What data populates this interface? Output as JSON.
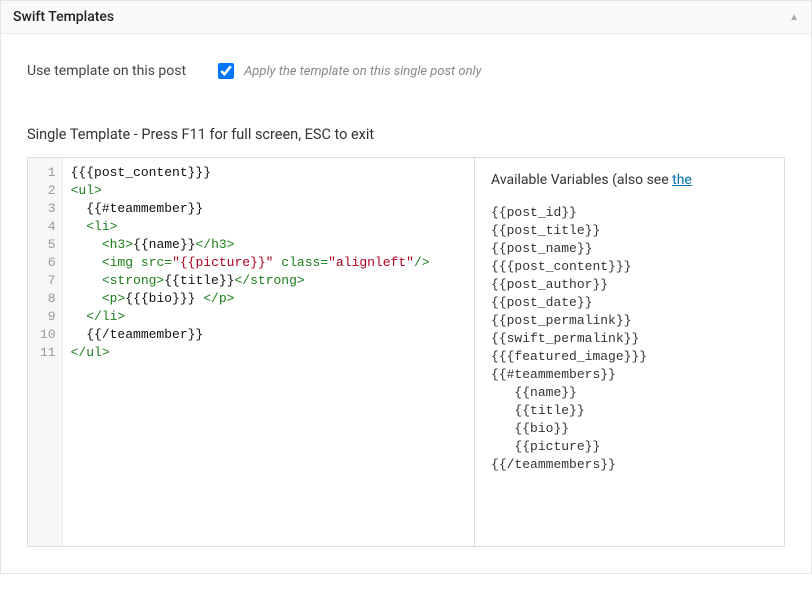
{
  "header": {
    "title": "Swift Templates"
  },
  "option": {
    "label": "Use template on this post",
    "checked": true,
    "desc": "Apply the template on this single post only"
  },
  "editor": {
    "title": "Single Template - Press F11 for full screen, ESC to exit",
    "lines": [
      [
        {
          "t": "{{{post_content}}}"
        }
      ],
      [
        {
          "t": "<ul>",
          "c": "t-tag"
        }
      ],
      [
        {
          "t": "  {{#teammember}}"
        }
      ],
      [
        {
          "t": "  "
        },
        {
          "t": "<li>",
          "c": "t-tag"
        }
      ],
      [
        {
          "t": "    "
        },
        {
          "t": "<h3>",
          "c": "t-tag"
        },
        {
          "t": "{{name}}"
        },
        {
          "t": "</h3>",
          "c": "t-tag"
        }
      ],
      [
        {
          "t": "    "
        },
        {
          "t": "<img ",
          "c": "t-tag"
        },
        {
          "t": "src",
          "c": "t-attr"
        },
        {
          "t": "=",
          "c": "t-punc"
        },
        {
          "t": "\"{{picture}}\"",
          "c": "t-str"
        },
        {
          "t": " "
        },
        {
          "t": "class",
          "c": "t-attr"
        },
        {
          "t": "=",
          "c": "t-punc"
        },
        {
          "t": "\"alignleft\"",
          "c": "t-str"
        },
        {
          "t": "/>",
          "c": "t-tag"
        }
      ],
      [
        {
          "t": "    "
        },
        {
          "t": "<strong>",
          "c": "t-tag"
        },
        {
          "t": "{{title}}"
        },
        {
          "t": "</strong>",
          "c": "t-tag"
        }
      ],
      [
        {
          "t": "    "
        },
        {
          "t": "<p>",
          "c": "t-tag"
        },
        {
          "t": "{{{bio}}} "
        },
        {
          "t": "</p>",
          "c": "t-tag"
        }
      ],
      [
        {
          "t": "  "
        },
        {
          "t": "</li>",
          "c": "t-tag"
        }
      ],
      [
        {
          "t": "  {{/teammember}}"
        }
      ],
      [
        {
          "t": "</ul>",
          "c": "t-tag"
        }
      ]
    ]
  },
  "vars": {
    "heading_prefix": "Available Variables (also see ",
    "heading_link": "the",
    "list": [
      "{{post_id}}",
      "{{post_title}}",
      "{{post_name}}",
      "{{{post_content}}}",
      "{{post_author}}",
      "{{post_date}}",
      "{{post_permalink}}",
      "{{swift_permalink}}",
      "{{{featured_image}}}",
      "{{#teammembers}}",
      "   {{name}}",
      "   {{title}}",
      "   {{bio}}",
      "   {{picture}}",
      "{{/teammembers}}"
    ]
  }
}
